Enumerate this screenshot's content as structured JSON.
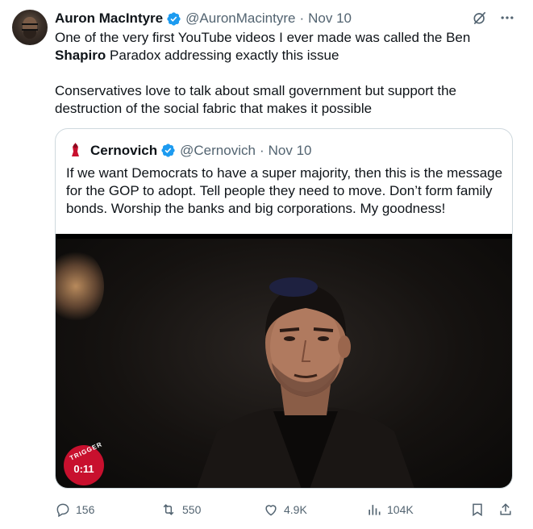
{
  "tweet": {
    "author_name": "Auron MacIntyre",
    "handle": "@AuronMacintyre",
    "date": "Nov 10",
    "text_p1_before": "One of the very first YouTube videos I ever made was called the Ben ",
    "text_p1_bold": "Shapiro",
    "text_p1_after": " Paradox addressing exactly this issue",
    "text_p2": "Conservatives love to talk about small government but support the destruction of the social fabric that makes it possible"
  },
  "quote": {
    "author_name": "Cernovich",
    "handle": "@Cernovich",
    "date": "Nov 10",
    "text": "If we want Democrats to have a super majority, then this is the message for the GOP to adopt. Tell people they need to move. Don’t form family bonds. Worship the banks and big corporations. My goodness!",
    "video": {
      "duration": "0:11",
      "badge_text": "TRIGGER"
    }
  },
  "actions": {
    "replies": "156",
    "reposts": "550",
    "likes": "4.9K",
    "views": "104K"
  },
  "colors": {
    "verified": "#1d9bf0",
    "muted": "#536471",
    "border": "#cfd9de",
    "badge": "#c8102e"
  },
  "icons": [
    "verified-badge-icon",
    "grok-icon",
    "more-icon",
    "reply-icon",
    "repost-icon",
    "like-icon",
    "views-icon",
    "bookmark-icon",
    "share-icon"
  ]
}
